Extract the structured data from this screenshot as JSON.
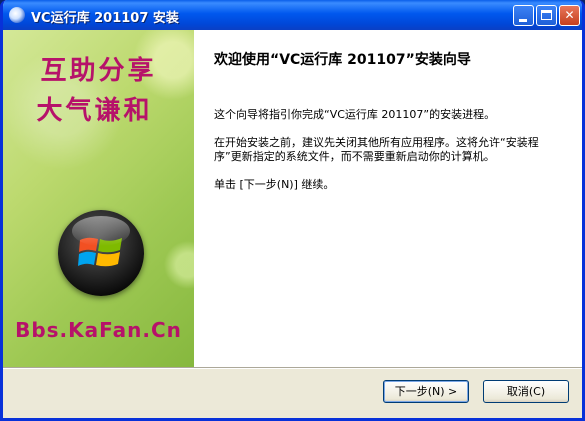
{
  "window": {
    "title": "VC运行库 201107 安装"
  },
  "banner": {
    "slogan_line1": "互助分享",
    "slogan_line2": "大气谦和",
    "site": "Bbs.KaFan.Cn",
    "colors": {
      "text": "#b6126a",
      "background": "#a8cd5c"
    }
  },
  "content": {
    "heading": "欢迎使用“VC运行库 201107”安装向导",
    "para1": "这个向导将指引你完成“VC运行库 201107”的安装进程。",
    "para2": "在开始安装之前，建议先关闭其他所有应用程序。这将允许“安装程序”更新指定的系统文件，而不需要重新启动你的计算机。",
    "para3": "单击 [下一步(N)] 继续。"
  },
  "buttons": {
    "next_label": "下一步(N) >",
    "cancel_label": "取消(C)"
  },
  "icons": {
    "title_icon": "installer-globe-icon",
    "minimize": "minimize-icon",
    "maximize": "maximize-icon",
    "close": "close-icon",
    "logo": "windows-logo-icon"
  }
}
